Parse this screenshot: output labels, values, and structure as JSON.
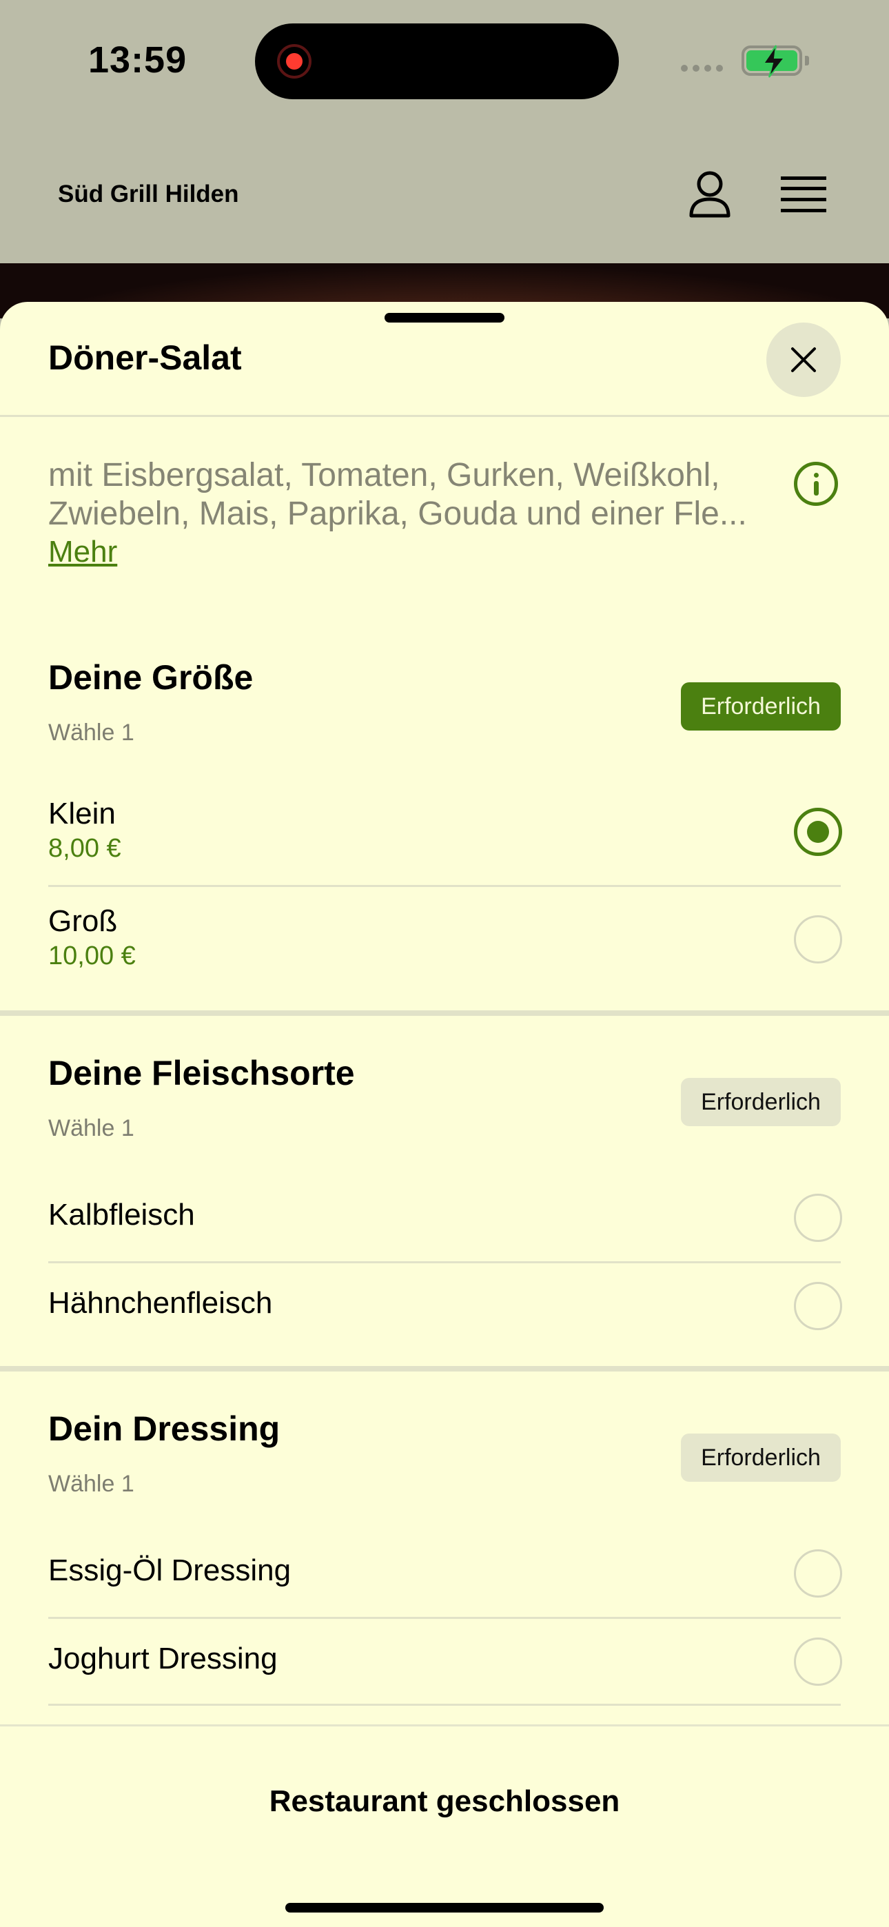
{
  "status_bar": {
    "time": "13:59"
  },
  "header": {
    "restaurant_name": "Süd Grill Hilden"
  },
  "sheet": {
    "title": "Döner-Salat",
    "description": "mit Eisbergsalat, Tomaten, Gurken, Weißkohl, Zwiebeln, Mais, Paprika, Gouda und einer Fle...",
    "more_label": "Mehr"
  },
  "groups": [
    {
      "title": "Deine Größe",
      "subtitle": "Wähle 1",
      "badge": "Erforderlich",
      "options": [
        {
          "name": "Klein",
          "price": "8,00 €",
          "selected": true
        },
        {
          "name": "Groß",
          "price": "10,00 €",
          "selected": false
        }
      ]
    },
    {
      "title": "Deine Fleischsorte",
      "subtitle": "Wähle 1",
      "badge": "Erforderlich",
      "options": [
        {
          "name": "Kalbfleisch",
          "selected": false
        },
        {
          "name": "Hähnchenfleisch",
          "selected": false
        }
      ]
    },
    {
      "title": "Dein Dressing",
      "subtitle": "Wähle 1",
      "badge": "Erforderlich",
      "options": [
        {
          "name": "Essig-Öl Dressing",
          "selected": false
        },
        {
          "name": "Joghurt Dressing",
          "selected": false
        }
      ]
    }
  ],
  "footer": {
    "label": "Restaurant geschlossen"
  },
  "colors": {
    "accent": "#4b8010",
    "sheet_bg": "#fdfed8",
    "header_bg": "#bbbca8"
  }
}
